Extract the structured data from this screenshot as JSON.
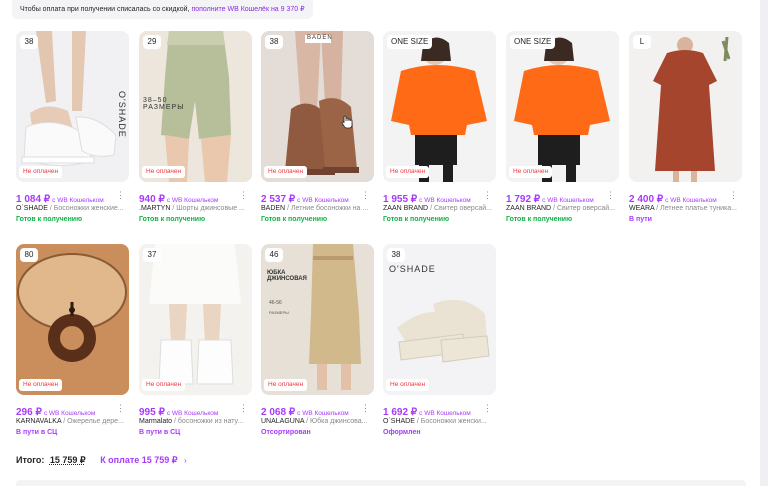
{
  "notice": {
    "text": "Чтобы оплата при получении списалась со скидкой,",
    "link": "пополните WB Кошелёк на 9 370 ₽"
  },
  "wallet_label": "с WB Кошельком",
  "more_icon": "⋮",
  "products": [
    {
      "size": "38",
      "status": "Не оплачен",
      "price": "1 084 ₽",
      "brand": "O`SHADE",
      "title": " / Босоножки женские...",
      "delivery": "Готов к получению",
      "delivery_type": "ready",
      "image": "white-sandals",
      "overlay": "O'SHADE"
    },
    {
      "size": "29",
      "status": "Не оплачен",
      "price": "940 ₽",
      "brand": ".MARTYN",
      "title": " / Шорты джинсовые ...",
      "delivery": "Готов к получению",
      "delivery_type": "ready",
      "image": "denim-shorts",
      "overlay": "38–50 РАЗМЕРЫ"
    },
    {
      "size": "38",
      "status": "Не оплачен",
      "price": "2 537 ₽",
      "brand": "BADEN",
      "title": " / Летние босоножки на ...",
      "delivery": "Готов к получению",
      "delivery_type": "ready",
      "image": "brown-heels",
      "overlay": "BADEN"
    },
    {
      "size": "ONE SIZE",
      "status": "Не оплачен",
      "price": "1 955 ₽",
      "brand": "ZAAN BRAND",
      "title": " / Свитер оверсай...",
      "delivery": "Готов к получению",
      "delivery_type": "ready",
      "image": "orange-sweater",
      "overlay": ""
    },
    {
      "size": "ONE SIZE",
      "status": "Не оплачен",
      "price": "1 792 ₽",
      "brand": "ZAAN BRAND",
      "title": " / Свитер оверсай...",
      "delivery": "Готов к получению",
      "delivery_type": "ready",
      "image": "orange-sweater",
      "overlay": ""
    },
    {
      "size": "L",
      "status": "",
      "price": "2 400 ₽",
      "brand": "WEARA",
      "title": " / Летнее платье туника...",
      "delivery": "В пути",
      "delivery_type": "transit",
      "image": "red-dress",
      "overlay": ""
    },
    {
      "size": "80",
      "status": "Не оплачен",
      "price": "296 ₽",
      "brand": "KARNAVALKA",
      "title": " / Ожерелье дере...",
      "delivery": "В пути в СЦ",
      "delivery_type": "transit",
      "image": "necklace",
      "overlay": ""
    },
    {
      "size": "37",
      "status": "Не оплачен",
      "price": "995 ₽",
      "brand": "Marmalato",
      "title": " / босоножки из нату...",
      "delivery": "В пути в СЦ",
      "delivery_type": "transit",
      "image": "white-platform",
      "overlay": ""
    },
    {
      "size": "46",
      "status": "Не оплачен",
      "price": "2 068 ₽",
      "brand": "UNALAGUNA",
      "title": " / Юбка джинсова...",
      "delivery": "Отсортирован",
      "delivery_type": "transit",
      "image": "beige-skirt",
      "overlay": "ЮБКА ДЖИНСОВАЯ"
    },
    {
      "size": "38",
      "status": "Не оплачен",
      "price": "1 692 ₽",
      "brand": "O`SHADE",
      "title": " / Босоножки женски...",
      "delivery": "Оформлен",
      "delivery_type": "transit",
      "image": "cream-sandals",
      "overlay": "O'SHADE"
    }
  ],
  "totals": {
    "label": "Итого:",
    "sum": "15 759 ₽",
    "pay_label": "К оплате 15 759 ₽",
    "chevron": "›"
  },
  "colors": {
    "accent": "#a73afd",
    "ready": "#13b047",
    "status_unpaid": "#f0353d"
  }
}
